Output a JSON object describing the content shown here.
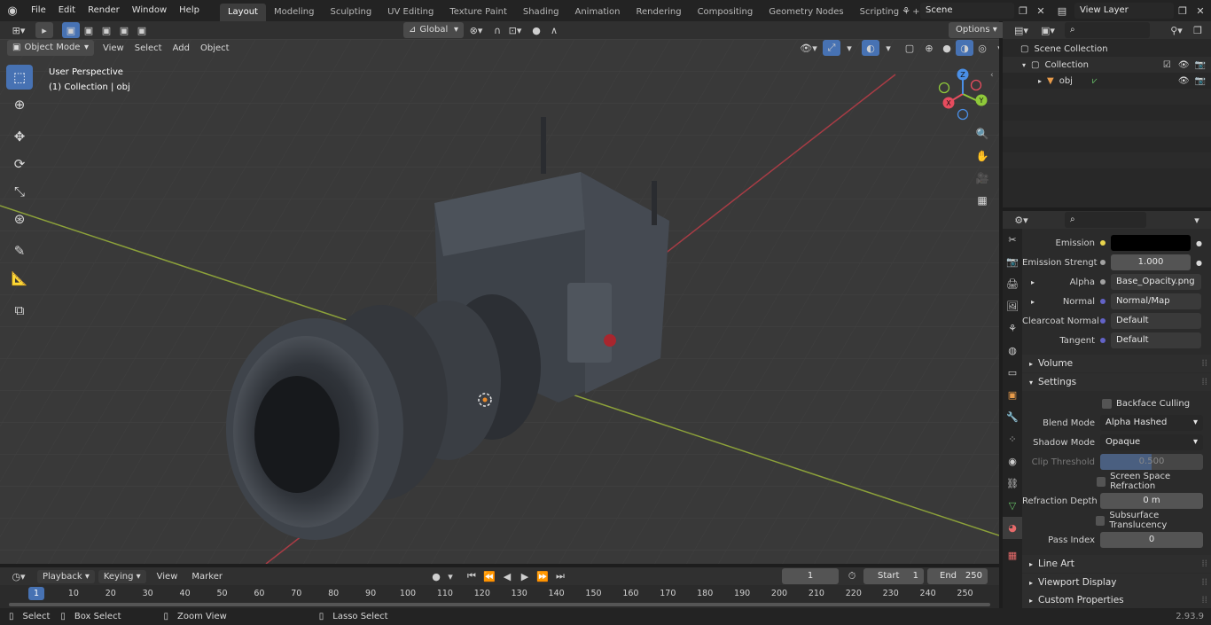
{
  "app": {
    "version": "2.93.9"
  },
  "menus": [
    "File",
    "Edit",
    "Render",
    "Window",
    "Help"
  ],
  "workspace_tabs": [
    "Layout",
    "Modeling",
    "Sculpting",
    "UV Editing",
    "Texture Paint",
    "Shading",
    "Animation",
    "Rendering",
    "Compositing",
    "Geometry Nodes",
    "Scripting"
  ],
  "active_workspace": "Layout",
  "scene": {
    "name": "Scene",
    "view_layer": "View Layer"
  },
  "viewport": {
    "mode": "Object Mode",
    "menus": [
      "View",
      "Select",
      "Add",
      "Object"
    ],
    "transform_orientation": "Global",
    "options_label": "Options",
    "overlay_title": "User Perspective",
    "overlay_subtitle": "(1) Collection | obj",
    "gizmo_axes": {
      "x": "X",
      "y": "Y",
      "z": "Z"
    }
  },
  "outliner": {
    "root": "Scene Collection",
    "collection": "Collection",
    "object": "obj"
  },
  "properties": {
    "rows_inputs": [
      {
        "label": "Emission",
        "value": "",
        "socket": "#e8d44d"
      },
      {
        "label": "Emission Strengt",
        "value": "1.000",
        "socket": "#a1a1a1"
      },
      {
        "label": "Alpha",
        "value": "Base_Opacity.png",
        "socket": "#a1a1a1"
      },
      {
        "label": "Normal",
        "value": "Normal/Map",
        "socket": "#6363c7"
      },
      {
        "label": "Clearcoat Normal",
        "value": "Default",
        "socket": "#6363c7"
      },
      {
        "label": "Tangent",
        "value": "Default",
        "socket": "#6363c7"
      }
    ],
    "sections": {
      "volume": "Volume",
      "settings": "Settings",
      "line_art": "Line Art",
      "viewport_display": "Viewport Display",
      "custom_properties": "Custom Properties"
    },
    "settings": {
      "backface_culling": "Backface Culling",
      "blend_mode_label": "Blend Mode",
      "blend_mode": "Alpha Hashed",
      "shadow_mode_label": "Shadow Mode",
      "shadow_mode": "Opaque",
      "clip_threshold_label": "Clip Threshold",
      "clip_threshold": "0.500",
      "ssr": "Screen Space Refraction",
      "refraction_depth_label": "Refraction Depth",
      "refraction_depth": "0 m",
      "subsurface": "Subsurface Translucency",
      "pass_index_label": "Pass Index",
      "pass_index": "0"
    }
  },
  "timeline": {
    "menus": [
      "Playback",
      "Keying",
      "View",
      "Marker"
    ],
    "current_frame": "1",
    "start_label": "Start",
    "start": "1",
    "end_label": "End",
    "end": "250",
    "ticks": [
      "10",
      "20",
      "30",
      "40",
      "50",
      "60",
      "70",
      "80",
      "90",
      "100",
      "110",
      "120",
      "130",
      "140",
      "150",
      "160",
      "170",
      "180",
      "190",
      "200",
      "210",
      "220",
      "230",
      "240",
      "250"
    ],
    "playhead": "1"
  },
  "statusbar": {
    "select": "Select",
    "box_select": "Box Select",
    "zoom_view": "Zoom View",
    "lasso_select": "Lasso Select"
  },
  "colors": {
    "accent": "#4772b3",
    "x_axis": "#e64c5e",
    "y_axis": "#8fc93a",
    "z_axis": "#4a8fe6"
  }
}
